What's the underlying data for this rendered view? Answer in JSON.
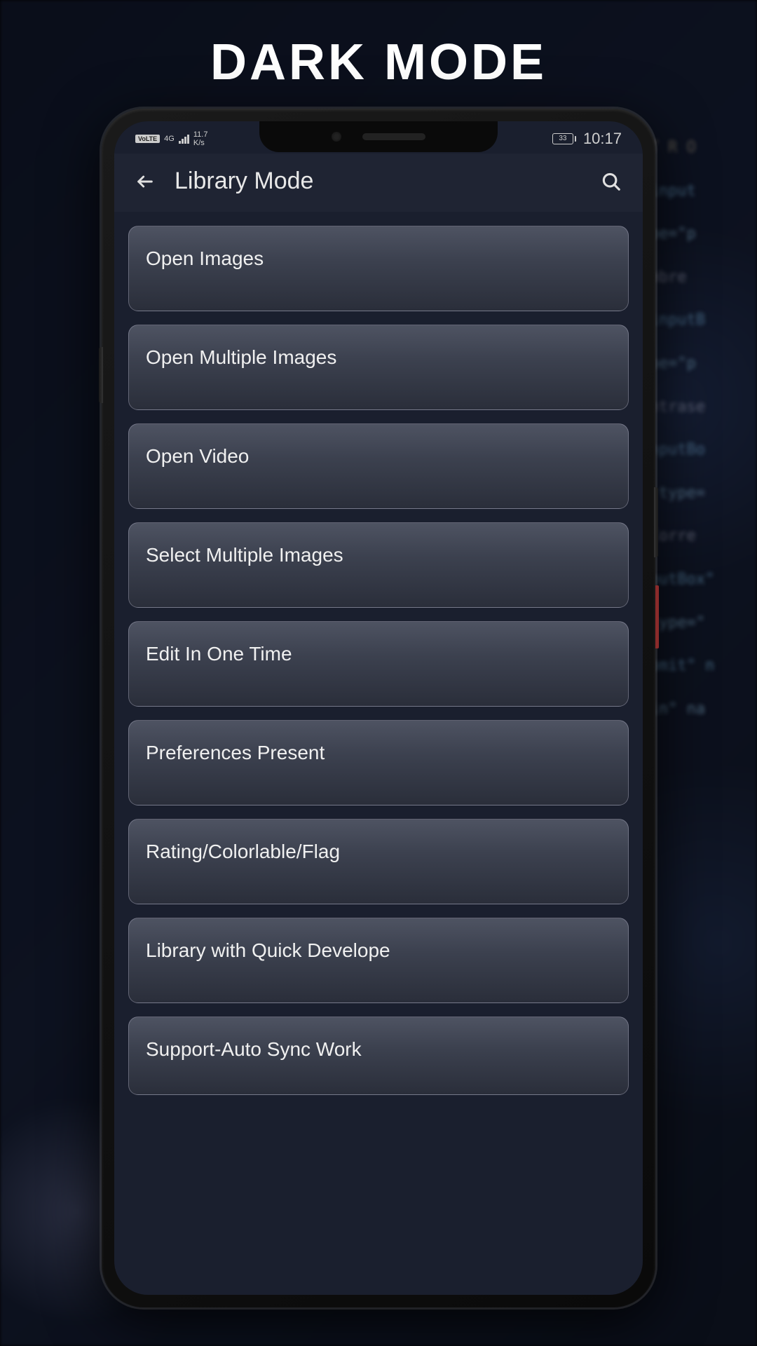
{
  "hero": {
    "title": "DARK MODE"
  },
  "status_bar": {
    "volte": "VoLTE",
    "network_type": "4G",
    "speed_value": "11.7",
    "speed_unit": "K/s",
    "battery": "33",
    "time": "10:17"
  },
  "header": {
    "title": "Library Mode"
  },
  "menu": {
    "items": [
      {
        "label": "Open Images"
      },
      {
        "label": "Open Multiple Images"
      },
      {
        "label": "Open Video"
      },
      {
        "label": "Select Multiple Images"
      },
      {
        "label": "Edit In One Time"
      },
      {
        "label": "Preferences Present"
      },
      {
        "label": "Rating/Colorlable/Flag"
      },
      {
        "label": "Library with Quick Develope"
      },
      {
        "label": "Support-Auto Sync Work"
      }
    ]
  }
}
